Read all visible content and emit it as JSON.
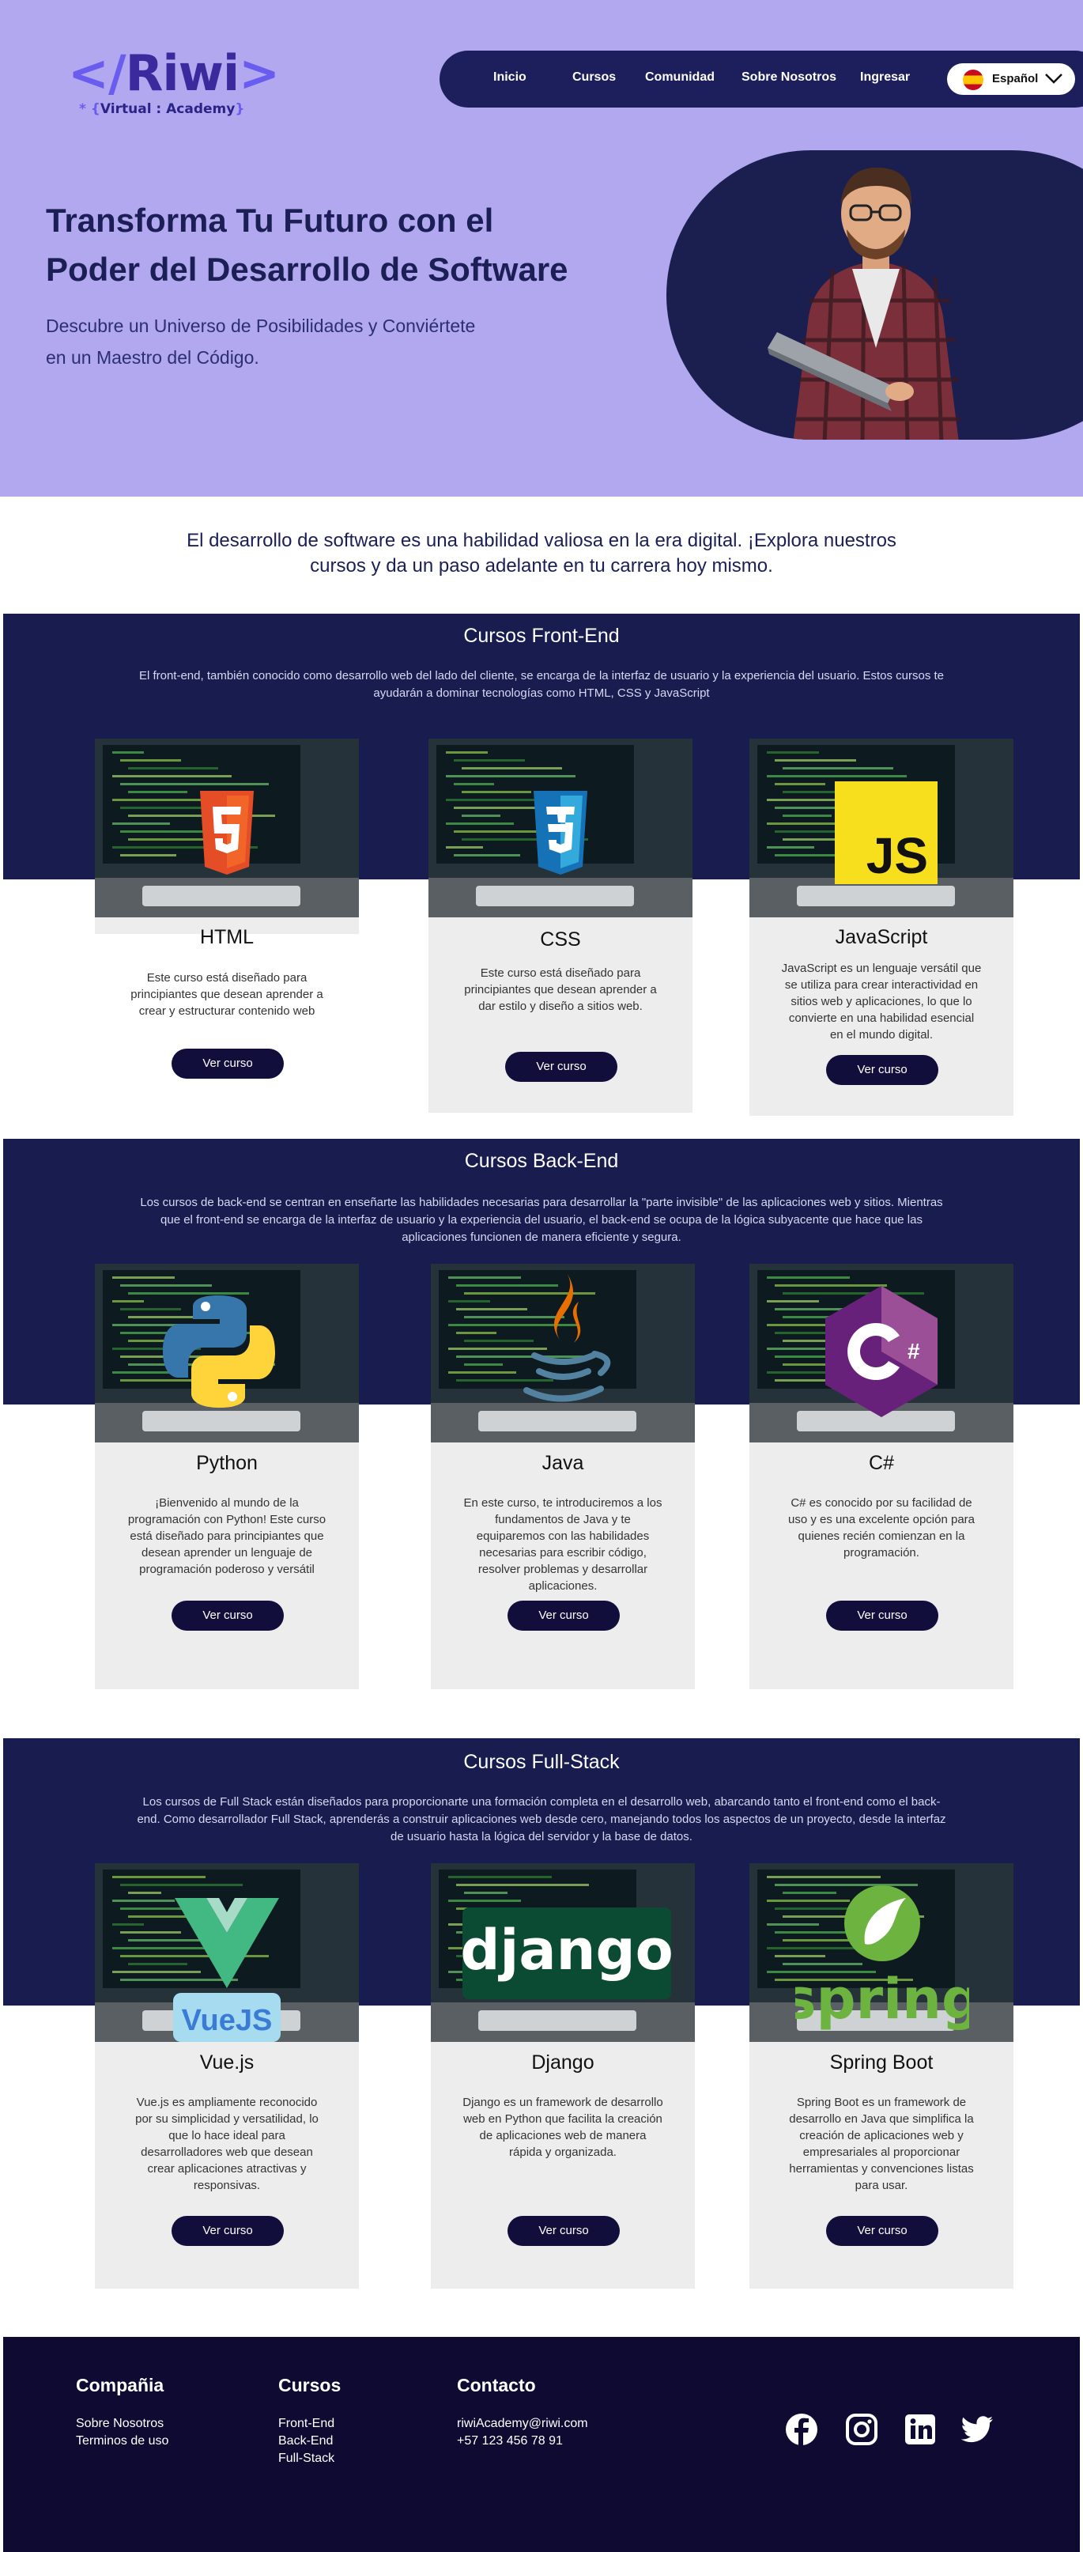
{
  "header": {
    "logo_text": "Riwi",
    "logo_subtext": "Virtual : Academy",
    "nav": [
      "Inicio",
      "Cursos",
      "Comunidad",
      "Sobre Nosotros",
      "Ingresar"
    ],
    "language": "Español"
  },
  "hero": {
    "title_line1": "Transforma Tu Futuro con el",
    "title_line2": "Poder del Desarrollo de Software",
    "subtitle_line1": "Descubre un Universo de Posibilidades y Conviértete",
    "subtitle_line2": "en un Maestro del Código."
  },
  "intro": {
    "line1": "El desarrollo de software es una habilidad valiosa en la era digital. ¡Explora nuestros",
    "line2": "cursos y da un paso adelante en tu carrera hoy mismo."
  },
  "frontend": {
    "title": "Cursos Front-End",
    "description": "El front-end, también conocido como desarrollo web del lado del cliente, se encarga de la interfaz de usuario y la experiencia del usuario. Estos cursos te ayudarán a dominar tecnologías como HTML, CSS y JavaScript",
    "cards": [
      {
        "title": "HTML",
        "description": "Este curso está diseñado para principiantes que desean aprender a crear y estructurar contenido web",
        "button": "Ver curso",
        "icon": "html5-icon"
      },
      {
        "title": "CSS",
        "description": "Este curso está diseñado para principiantes que desean aprender a dar estilo y diseño a sitios web.",
        "button": "Ver curso",
        "icon": "css3-icon"
      },
      {
        "title": "JavaScript",
        "description": "JavaScript es un lenguaje versátil que se utiliza para crear interactividad en sitios web y aplicaciones, lo que lo convierte en una habilidad esencial en el mundo digital.",
        "button": "Ver curso",
        "icon": "javascript-icon"
      }
    ]
  },
  "backend": {
    "title": "Cursos Back-End",
    "description": "Los cursos de back-end se centran en enseñarte las habilidades necesarias para desarrollar la \"parte invisible\" de las aplicaciones web y sitios. Mientras que el front-end se encarga de la interfaz de usuario y la experiencia del usuario, el back-end se ocupa de la lógica subyacente que hace que las aplicaciones funcionen de manera eficiente y segura.",
    "cards": [
      {
        "title": "Python",
        "description": "¡Bienvenido al mundo de la programación con Python! Este curso está diseñado para principiantes que desean aprender un lenguaje de programación poderoso y versátil",
        "button": "Ver curso",
        "icon": "python-icon"
      },
      {
        "title": "Java",
        "description": "En este curso, te introduciremos a los fundamentos de Java y te equiparemos con las habilidades necesarias para escribir código, resolver problemas y desarrollar aplicaciones.",
        "button": "Ver curso",
        "icon": "java-icon"
      },
      {
        "title": "C#",
        "description": "C# es conocido por su facilidad de uso y es una excelente opción para quienes recién comienzan en la programación.",
        "button": "Ver curso",
        "icon": "csharp-icon"
      }
    ]
  },
  "fullstack": {
    "title": "Cursos Full-Stack",
    "description": "Los cursos de Full Stack están diseñados para proporcionarte una formación completa en el desarrollo web, abarcando tanto el front-end como el back-end. Como desarrollador Full Stack, aprenderás a construir aplicaciones web desde cero, manejando todos los aspectos de un proyecto, desde la interfaz de usuario hasta la lógica del servidor y la base de datos.",
    "cards": [
      {
        "title": "Vue.js",
        "description": "Vue.js es ampliamente reconocido por su simplicidad y versatilidad, lo que lo hace ideal para desarrolladores web que desean crear aplicaciones atractivas y responsivas.",
        "button": "Ver curso",
        "icon": "vuejs-icon",
        "logo_text": "VueJS"
      },
      {
        "title": "Django",
        "description": "Django es un framework de desarrollo web en Python que facilita la creación de aplicaciones web de manera rápida y organizada.",
        "button": "Ver curso",
        "icon": "django-icon",
        "logo_text": "django"
      },
      {
        "title": "Spring Boot",
        "description": "Spring Boot es un framework de desarrollo en Java que simplifica la creación de aplicaciones web y empresariales al proporcionar herramientas y convenciones listas para usar.",
        "button": "Ver curso",
        "icon": "spring-icon",
        "logo_text": "spring"
      }
    ]
  },
  "footer": {
    "company_heading": "Compañia",
    "company_links": [
      "Sobre Nosotros",
      "Terminos de uso"
    ],
    "courses_heading": "Cursos",
    "courses_links": [
      "Front-End",
      "Back-End",
      "Full-Stack"
    ],
    "contact_heading": "Contacto",
    "email": "riwiAcademy@riwi.com",
    "phone": "+57 123 456 78 91",
    "social_icons": [
      "facebook-icon",
      "instagram-icon",
      "linkedin-icon",
      "twitter-icon"
    ]
  },
  "colors": {
    "hero_bg": "#b1a8ef",
    "navy": "#181c4f",
    "button": "#110e3b",
    "card_bg": "#ededed",
    "footer_bg": "#0e0a32"
  }
}
